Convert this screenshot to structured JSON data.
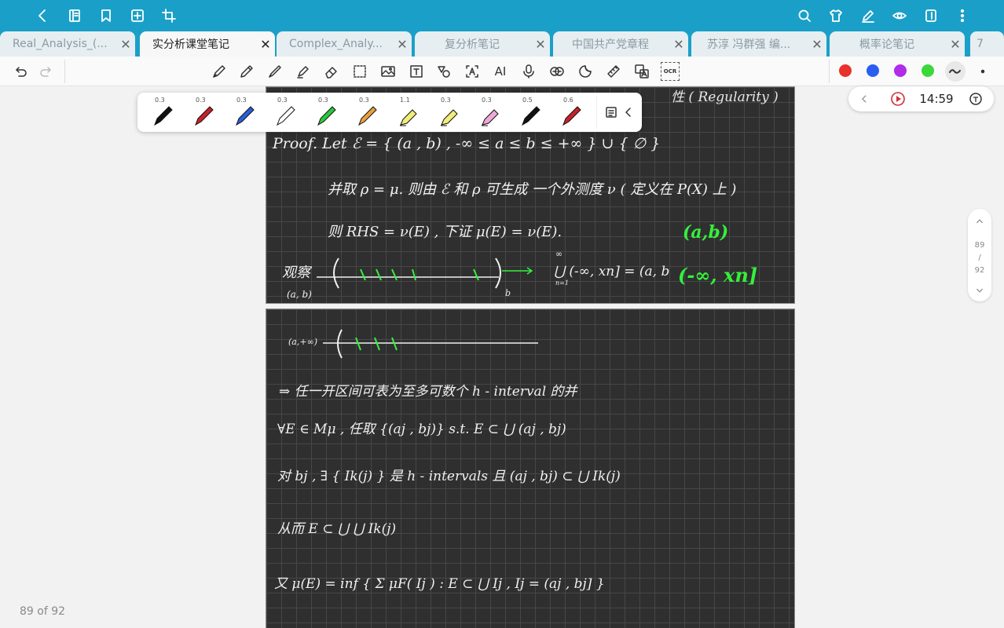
{
  "tabs": [
    {
      "label": "Real_Analysis_(...",
      "active": false
    },
    {
      "label": "实分析课堂笔记",
      "active": true
    },
    {
      "label": "Complex_Analy...",
      "active": false
    },
    {
      "label": "复分析笔记",
      "active": false
    },
    {
      "label": "中国共产党章程",
      "active": false
    },
    {
      "label": "苏淳 冯群强 编...",
      "active": false
    },
    {
      "label": "概率论笔记",
      "active": false
    },
    {
      "label": "7",
      "active": false
    }
  ],
  "tab_close": "✕",
  "tools": {
    "ai_label": "AI",
    "ocr_label": "OCR"
  },
  "colors": [
    "#e8322a",
    "#2a5ef0",
    "#b02ce8",
    "#3ad83a"
  ],
  "pens": [
    {
      "width": "0.3",
      "color": "#111111"
    },
    {
      "width": "0.3",
      "color": "#c8202a"
    },
    {
      "width": "0.3",
      "color": "#2a5ed8"
    },
    {
      "width": "0.3",
      "color": "#ffffff"
    },
    {
      "width": "0.3",
      "color": "#2ac83a"
    },
    {
      "width": "0.3",
      "color": "#e8a040"
    },
    {
      "width": "1.1",
      "color": "#f2ee7a"
    },
    {
      "width": "0.3",
      "color": "#f2ee7a"
    },
    {
      "width": "0.3",
      "color": "#f0a8d8"
    },
    {
      "width": "0.5",
      "color": "#111111"
    },
    {
      "width": "0.6",
      "color": "#c8202a"
    }
  ],
  "timer": {
    "time": "14:59"
  },
  "scroller": {
    "current": "89",
    "slash": "/",
    "total": "92"
  },
  "page_counter": "89 of 92",
  "note": {
    "p1_regularity": "性 ( Regularity )",
    "p1_proof": "Proof.   Let   ℰ = { (a , b) , -∞ ≤ a ≤ b ≤ +∞ } ∪ { ∅ }",
    "p1_line2": "并取  ρ = μ.  则由 ℰ 和 ρ 可生成 一个外测度 ν ( 定义在 P(X) 上 )",
    "p1_line3": "则 RHS = ν(E) ,  下证  μ(E) = ν(E).",
    "p1_green_ab": "(a,b)",
    "p1_observe": "观察",
    "p1_ab_small": "(a, b)",
    "p1_b": "b",
    "p1_union": "⋃ (-∞, xn] = (a, b",
    "p1_union_n": "n=1",
    "p1_inf": "∞",
    "p1_green_big": "(-∞, xn]",
    "p2_a_inf": "(a,+∞)",
    "p2_line1": "⇒ 任一开区间可表为至多可数个  h - interval  的并",
    "p2_line2": "∀E ∈ Mμ ,   任取 {(aj , bj)}   s.t.      E ⊂ ⋃ (aj , bj)",
    "p2_line3": "对 bj ,  ∃ { Ik(j) }     是  h - intervals    且     (aj , bj) ⊂ ⋃ Ik(j)",
    "p2_line4": "从而    E ⊂ ⋃ ⋃ Ik(j)",
    "p2_line5": "又 μ(E) = inf { Σ μF( Ij ) :  E ⊂ ⋃ Ij  ,  Ij = (aj , bj] }"
  }
}
